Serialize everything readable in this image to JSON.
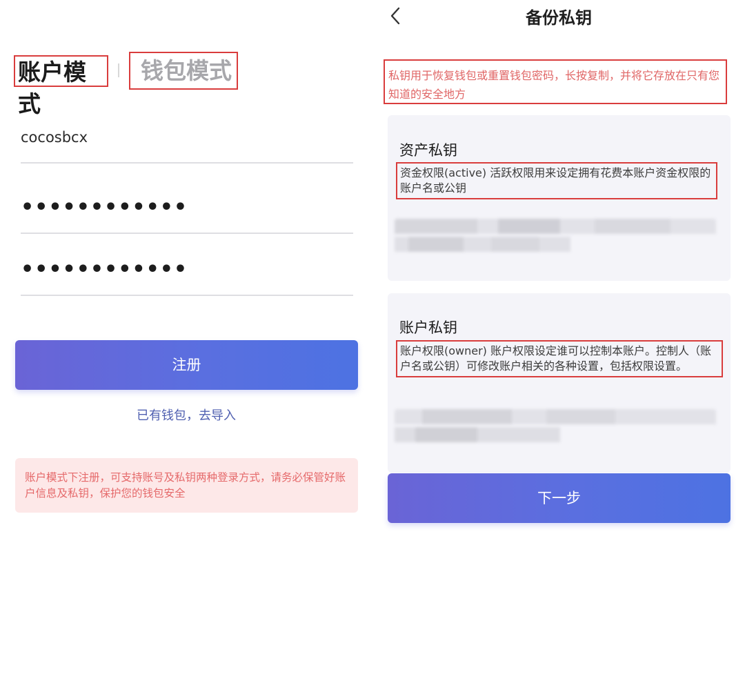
{
  "left": {
    "tabs": {
      "account_mode": "账户模式",
      "wallet_mode": "钱包模式"
    },
    "form": {
      "username_value": "cocosbcx",
      "password_mask": "••••••••••••",
      "confirm_password_mask": "••••••••••••"
    },
    "register_button": "注册",
    "import_link": "已有钱包，去导入",
    "notice": "账户模式下注册，可支持账号及私钥两种登录方式，请务必保管好账户信息及私钥，保护您的钱包安全"
  },
  "right": {
    "header": {
      "title": "备份私钥",
      "back_icon": "chevron-left-icon"
    },
    "warning": "私钥用于恢复钱包或重置钱包密码，长按复制，并将它存放在只有您知道的安全地方",
    "asset_key": {
      "title": "资产私钥",
      "description": "资金权限(active) 活跃权限用来设定拥有花费本账户资金权限的账户名或公钥"
    },
    "account_key": {
      "title": "账户私钥",
      "description": "账户权限(owner) 账户权限设定谁可以控制本账户。控制人（账户名或公钥）可修改账户相关的各种设置，包括权限设置。"
    },
    "next_button": "下一步"
  },
  "colors": {
    "accent_gradient_start": "#6a64d6",
    "accent_gradient_end": "#4d72e2",
    "highlight_border": "#d93c3c",
    "notice_background": "#fde8e8",
    "notice_text": "#e5696a"
  }
}
